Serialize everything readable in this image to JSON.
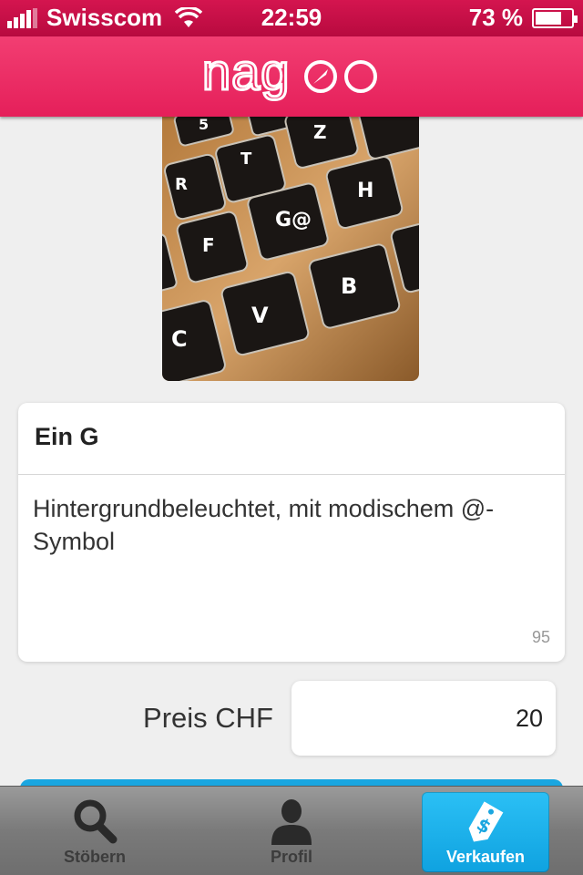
{
  "status_bar": {
    "carrier": "Swisscom",
    "time": "22:59",
    "battery_percent": "73 %",
    "battery_level": 0.73,
    "signal_bars": 4
  },
  "header": {
    "logo_text": "nagoo",
    "color": "#e8285f"
  },
  "photo": {
    "icon": "keyboard-photo",
    "keys": [
      "5",
      "T",
      "Z",
      "R",
      "H",
      "G@",
      "F",
      "C",
      "V",
      "B"
    ]
  },
  "listing": {
    "title": "Ein G",
    "description": "Hintergrundbeleuchtet, mit modischem @-Symbol",
    "char_count": "95"
  },
  "price": {
    "label": "Preis CHF",
    "value": "20"
  },
  "tabs": [
    {
      "label": "Stöbern",
      "icon": "search-icon",
      "active": false
    },
    {
      "label": "Profil",
      "icon": "person-icon",
      "active": false
    },
    {
      "label": "Verkaufen",
      "icon": "price-tag-icon",
      "active": true
    }
  ],
  "colors": {
    "accent": "#e8285f",
    "tab_active": "#1aa6e0"
  }
}
